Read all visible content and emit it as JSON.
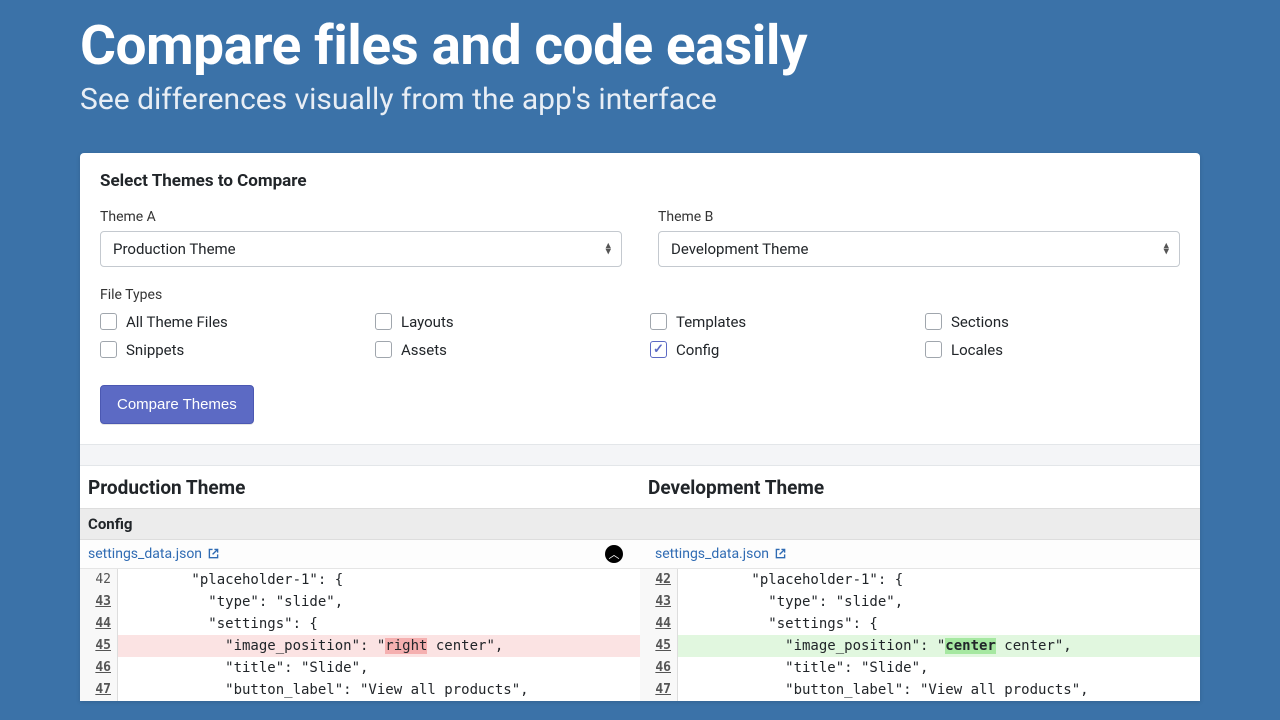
{
  "hero": {
    "title": "Compare files and code easily",
    "subtitle": "See differences visually from the app's interface"
  },
  "form": {
    "section_title": "Select Themes to Compare",
    "theme_a_label": "Theme A",
    "theme_a_value": "Production Theme",
    "theme_b_label": "Theme B",
    "theme_b_value": "Development Theme",
    "file_types_label": "File Types",
    "file_types": [
      {
        "label": "All Theme Files",
        "checked": false
      },
      {
        "label": "Layouts",
        "checked": false
      },
      {
        "label": "Templates",
        "checked": false
      },
      {
        "label": "Sections",
        "checked": false
      },
      {
        "label": "Snippets",
        "checked": false
      },
      {
        "label": "Assets",
        "checked": false
      },
      {
        "label": "Config",
        "checked": true
      },
      {
        "label": "Locales",
        "checked": false
      }
    ],
    "compare_button": "Compare Themes"
  },
  "diff": {
    "left_title": "Production Theme",
    "right_title": "Development Theme",
    "group": "Config",
    "file_left": "settings_data.json",
    "file_right": "settings_data.json",
    "lines_left": [
      {
        "n": "42",
        "u": false,
        "cls": "",
        "text": "        \"placeholder-1\": {"
      },
      {
        "n": "43",
        "u": true,
        "cls": "",
        "text": "          \"type\": \"slide\","
      },
      {
        "n": "44",
        "u": true,
        "cls": "",
        "text": "          \"settings\": {"
      },
      {
        "n": "45",
        "u": true,
        "cls": "del",
        "pre": "            \"image_position\": \"",
        "diff": "right",
        "post": " center\","
      },
      {
        "n": "46",
        "u": true,
        "cls": "",
        "text": "            \"title\": \"Slide\","
      },
      {
        "n": "47",
        "u": true,
        "cls": "",
        "text": "            \"button_label\": \"View all products\","
      }
    ],
    "lines_right": [
      {
        "n": "42",
        "u": true,
        "cls": "",
        "text": "        \"placeholder-1\": {"
      },
      {
        "n": "43",
        "u": true,
        "cls": "",
        "text": "          \"type\": \"slide\","
      },
      {
        "n": "44",
        "u": true,
        "cls": "",
        "text": "          \"settings\": {"
      },
      {
        "n": "45",
        "u": true,
        "cls": "add",
        "pre": "            \"image_position\": \"",
        "diff": "center",
        "post": " center\","
      },
      {
        "n": "46",
        "u": true,
        "cls": "",
        "text": "            \"title\": \"Slide\","
      },
      {
        "n": "47",
        "u": true,
        "cls": "",
        "text": "            \"button_label\": \"View all products\","
      }
    ]
  }
}
